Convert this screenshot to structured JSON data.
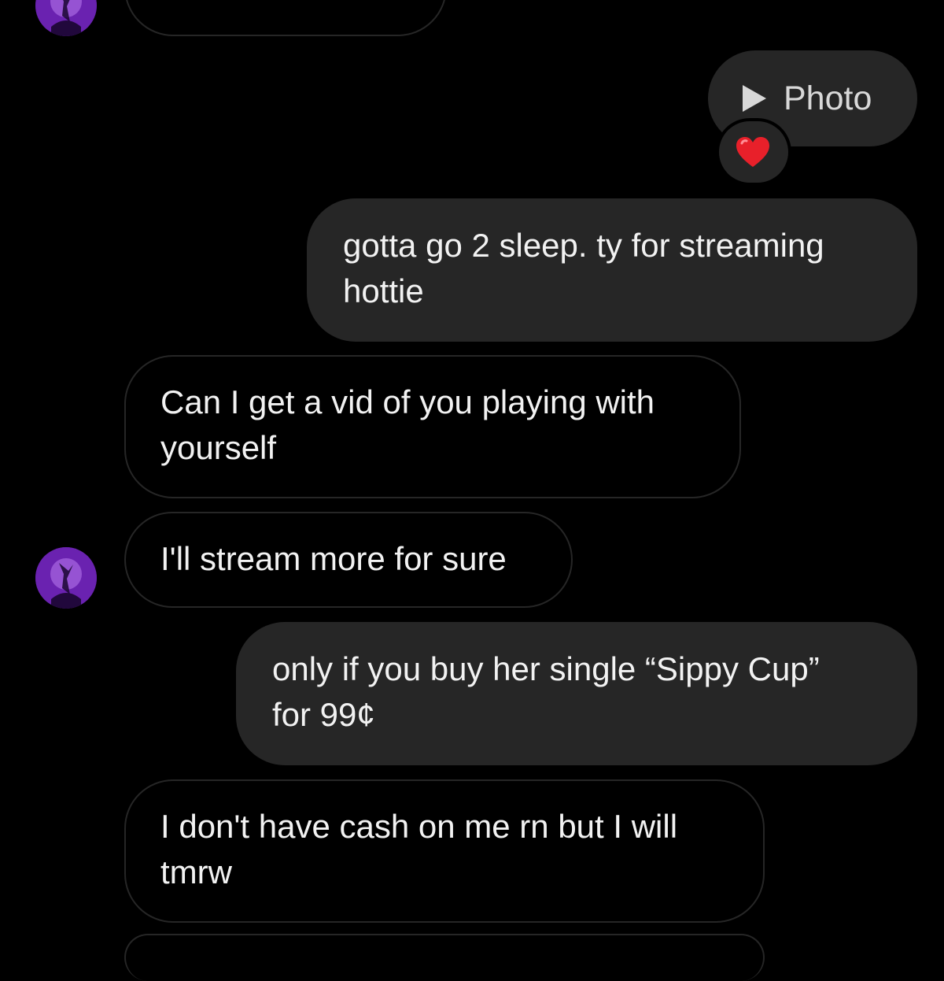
{
  "conversation": {
    "photo_message": {
      "label": "Photo",
      "icon": "play-icon",
      "reaction": "heart-icon"
    },
    "messages": [
      {
        "sender": "me",
        "text_lines": [
          "gotta go 2 sleep. ty for streaming",
          "hottie"
        ]
      },
      {
        "sender": "them",
        "text_lines": [
          "Can I get a vid of you playing with",
          "yourself"
        ]
      },
      {
        "sender": "them",
        "text_lines": [
          "I'll stream more for sure"
        ]
      },
      {
        "sender": "me",
        "text_lines": [
          "only if you buy her single “Sippy Cup”",
          "for 99¢"
        ]
      },
      {
        "sender": "them",
        "text_lines": [
          "I don't have cash on me rn but I will",
          "tmrw"
        ]
      }
    ]
  },
  "colors": {
    "background": "#000000",
    "outgoing_bubble": "#262626",
    "incoming_border": "#262626",
    "text": "#f2f2f2",
    "avatar_accent": "#7a2fc4",
    "heart": "#e8202a"
  }
}
